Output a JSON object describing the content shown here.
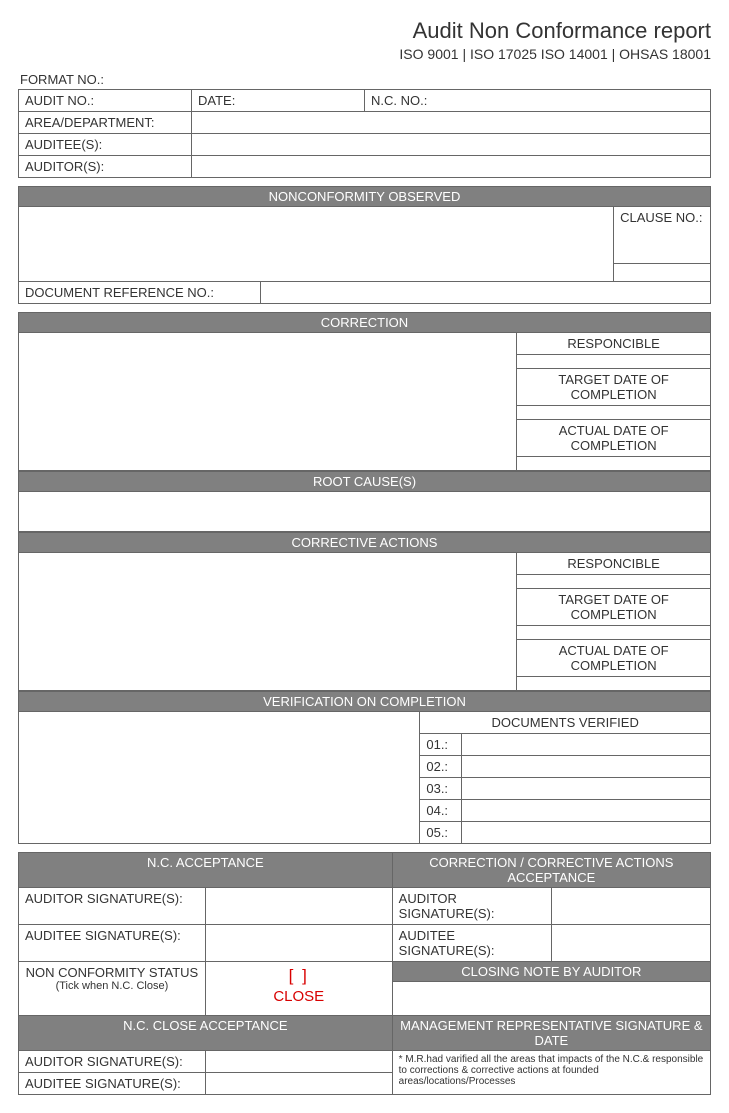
{
  "header": {
    "title": "Audit Non Conformance report",
    "subtitle": "ISO 9001 | ISO 17025 ISO 14001 | OHSAS 18001",
    "format_no_label": "FORMAT NO.:"
  },
  "basic": {
    "audit_no_label": "AUDIT NO.:",
    "date_label": "DATE:",
    "nc_no_label": "N.C. NO.:",
    "area_label": "AREA/DEPARTMENT:",
    "auditee_label": "AUDITEE(S):",
    "auditor_label": "AUDITOR(S):"
  },
  "nonconformity": {
    "header": "NONCONFORMITY OBSERVED",
    "clause_label": "CLAUSE NO.:",
    "doc_ref_label": "DOCUMENT REFERENCE NO.:"
  },
  "correction": {
    "header": "CORRECTION",
    "responsible": "RESPONCIBLE",
    "target_date": "TARGET DATE OF COMPLETION",
    "actual_date": "ACTUAL DATE OF COMPLETION"
  },
  "root_cause": {
    "header": "ROOT CAUSE(S)"
  },
  "corrective": {
    "header": "CORRECTIVE ACTIONS",
    "responsible": "RESPONCIBLE",
    "target_date": "TARGET DATE OF COMPLETION",
    "actual_date": "ACTUAL DATE OF COMPLETION"
  },
  "verification": {
    "header": "VERIFICATION ON COMPLETION",
    "docs_verified": "DOCUMENTS VERIFIED",
    "rows": [
      "01.:",
      "02.:",
      "03.:",
      "04.:",
      "05.:"
    ]
  },
  "acceptance": {
    "nc_header": "N.C. ACCEPTANCE",
    "cc_header": "CORRECTION / CORRECTIVE ACTIONS ACCEPTANCE",
    "auditor_sig": "AUDITOR SIGNATURE(S):",
    "auditee_sig": "AUDITEE SIGNATURE(S):",
    "status_label": "NON CONFORMITY STATUS",
    "tick_note": "(Tick when N.C. Close)",
    "brackets": "[           ]",
    "close": "CLOSE",
    "closing_note": "CLOSING NOTE BY AUDITOR",
    "close_header": "N.C. CLOSE ACCEPTANCE",
    "mgmt_header": "MANAGEMENT REPRESENTATIVE SIGNATURE & DATE",
    "mr_note": "* M.R.had varified all the areas that impacts of the N.C.& responsible to corrections & corrective actions at founded areas/locations/Processes"
  }
}
